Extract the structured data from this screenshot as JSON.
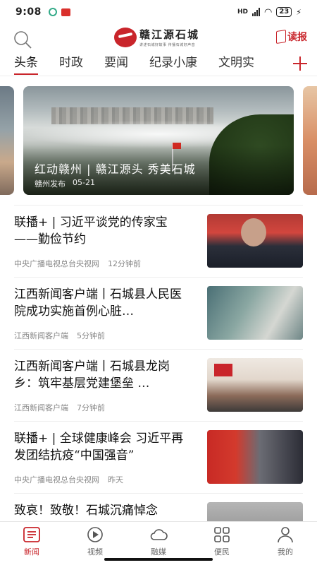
{
  "status_bar": {
    "time": "9:08",
    "battery": "23"
  },
  "header": {
    "logo_title": "赣江源石城",
    "logo_subtitle": "讲述石城好故事 传播石城好声音",
    "read_label": "读报"
  },
  "tabs": [
    "头条",
    "时政",
    "要闻",
    "纪录小康",
    "文明实"
  ],
  "carousel": {
    "title": "红动赣州 | 赣江源头 秀美石城",
    "source": "赣州发布",
    "date": "05-21"
  },
  "news": [
    {
      "title": "联播+ | 习近平谈党的传家宝——勤俭节约",
      "source": "中央广播电视总台央视网",
      "time": "12分钟前"
    },
    {
      "title": "江西新闻客户端丨石城县人民医院成功实施首例心脏…",
      "source": "江西新闻客户端",
      "time": "5分钟前"
    },
    {
      "title": "江西新闻客户端丨石城县龙岗乡：筑牢基层党建堡垒 …",
      "source": "江西新闻客户端",
      "time": "7分钟前"
    },
    {
      "title": "联播+ | 全球健康峰会 习近平再发团结抗疫“中国强音”",
      "source": "中央广播电视总台央视网",
      "time": "昨天"
    },
    {
      "title": "致哀！致敬！石城沉痛悼念",
      "source": "",
      "time": ""
    }
  ],
  "bottom_nav": [
    {
      "label": "新闻",
      "icon": "news-icon",
      "active": true
    },
    {
      "label": "视频",
      "icon": "play-icon",
      "active": false
    },
    {
      "label": "融媒",
      "icon": "cloud-icon",
      "active": false
    },
    {
      "label": "便民",
      "icon": "grid-icon",
      "active": false
    },
    {
      "label": "我的",
      "icon": "user-icon",
      "active": false
    }
  ],
  "colors": {
    "accent": "#c9252b",
    "text": "#111111",
    "meta": "#888888"
  }
}
